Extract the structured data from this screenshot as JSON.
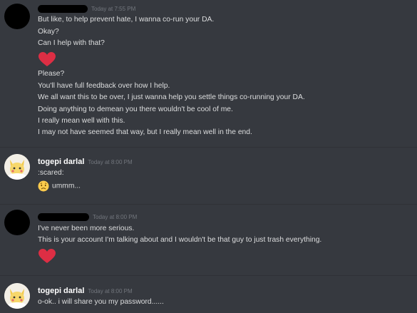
{
  "messages": [
    {
      "author": "",
      "timestamp": "Today at 7:55 PM",
      "lines": [
        "But like, to help prevent hate, I wanna co-run your DA.",
        "Okay?",
        "Can I help with that?",
        "Please?",
        "You'll have full feedback over how I help.",
        "We all want this to be over, I just wanna help you settle things co-running your DA.",
        "Doing anything to demean you there wouldn't be cool of me.",
        "I really mean well with this.",
        "I may not have seemed that way, but I really mean well in the end."
      ],
      "emoji": "heart"
    },
    {
      "author": "togepi darlal",
      "timestamp": "Today at 8:00 PM",
      "lines": [
        ":scared:",
        "ummm..."
      ],
      "emoji": "worried-face"
    },
    {
      "author": "",
      "timestamp": "Today at 8:00 PM",
      "lines": [
        "I've never been more serious.",
        "This is your account I'm talking about and I wouldn't be that guy to just trash everything."
      ],
      "emoji": "heart"
    },
    {
      "author": "togepi darlal",
      "timestamp": "Today at 8:00 PM",
      "lines": [
        "o-ok.. i will share you my password......"
      ]
    }
  ],
  "colors": {
    "background": "#36393f",
    "text": "#dcddde",
    "username": "#ffffff",
    "timestamp": "#72767d",
    "heart": "#dd2e44"
  }
}
